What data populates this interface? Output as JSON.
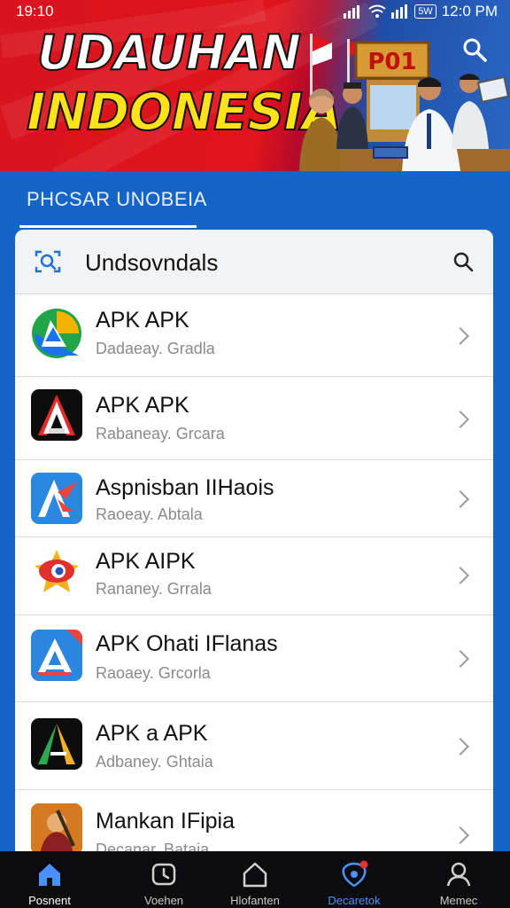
{
  "status_bar": {
    "time": "19:10",
    "battery": "5W",
    "clock_right": "12:0 PM"
  },
  "banner": {
    "title_line1": "UDAUHAN",
    "title_line2": "INDONESIA",
    "booth_sign": "P01"
  },
  "section": {
    "title": "PHCSAR UNOBEIA"
  },
  "search_card": {
    "label": "Undsovndals"
  },
  "apps": [
    {
      "name": "APK APK",
      "sub": "Dadaeay. Gradla",
      "icon": "green-blue-triangle-icon"
    },
    {
      "name": "APK APK",
      "sub": "Rabaneay. Grcara",
      "icon": "red-a-on-black-icon"
    },
    {
      "name": "Aspnisban IIHaois",
      "sub": "Raoeay. Abtala",
      "icon": "blue-red-a-icon"
    },
    {
      "name": "APK AIPK",
      "sub": "Rananey. Grrala",
      "icon": "red-eye-star-icon"
    },
    {
      "name": "APK Ohati IFlanas",
      "sub": "Raoaey. Grcorla",
      "icon": "blue-a-red-corner-icon"
    },
    {
      "name": "APK a APK",
      "sub": "Adbaney. Ghtaia",
      "icon": "green-a-on-black-icon"
    },
    {
      "name": "Mankan IFipia",
      "sub": "Decanar. Bataia",
      "icon": "orange-illustration-icon"
    }
  ],
  "bottom_nav": [
    {
      "label": "Posnent",
      "icon": "home-icon",
      "active": false
    },
    {
      "label": "Voehen",
      "icon": "timer-icon",
      "active": false
    },
    {
      "label": "Hlofanten",
      "icon": "house-outline-icon",
      "active": false
    },
    {
      "label": "Decaretok",
      "icon": "shield-badge-icon",
      "active": true
    },
    {
      "label": "Memec",
      "icon": "person-icon",
      "active": false
    }
  ],
  "colors": {
    "primary_blue": "#1565c8",
    "banner_red": "#e0141c",
    "title_yellow": "#ffe21a",
    "nav_active": "#4a90ff"
  }
}
